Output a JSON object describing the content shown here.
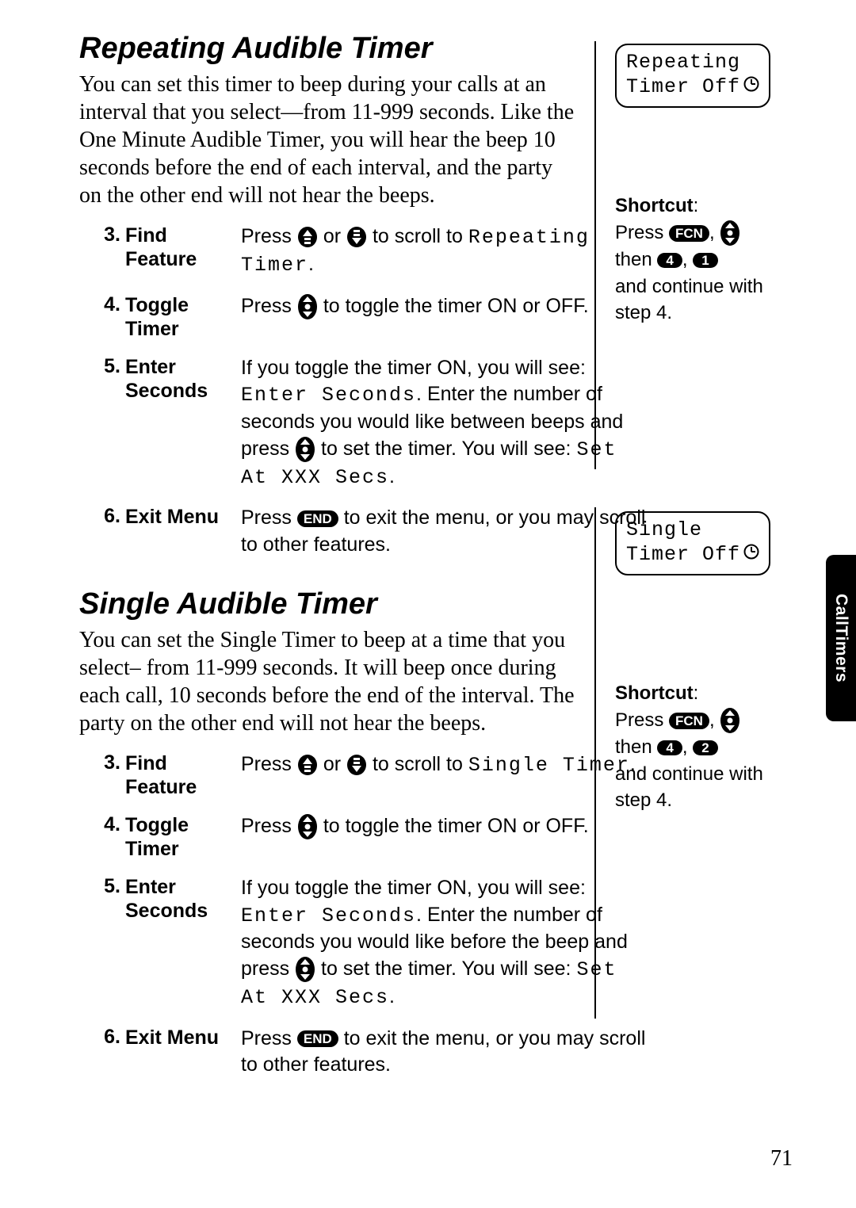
{
  "page_number": "71",
  "side_tab": "CallTimers",
  "sections": [
    {
      "title": "Repeating Audible Timer",
      "intro": "You can set this timer to beep during your calls at an interval that you select—from 11-999 seconds. Like the One Minute Audible Timer, you will hear the beep 10 seconds before the end of each interval, and the party on the other end will not hear the beeps.",
      "display": {
        "line1": "Repeating",
        "line2": "Timer Off"
      },
      "shortcut": {
        "label": "Shortcut",
        "line1_pre": "Press ",
        "fcn": "FCN",
        "then": "then",
        "digit1": "4",
        "digit2": "1",
        "tail": "and continue with step 4."
      },
      "steps": [
        {
          "num": "3.",
          "label": "Find Feature",
          "pre": "Press ",
          "mid": " or ",
          "post": " to scroll to ",
          "lcd": "Repeating Timer",
          "trail": "."
        },
        {
          "num": "4.",
          "label": "Toggle Timer",
          "pre": "Press ",
          "post": " to toggle the timer ON or OFF."
        },
        {
          "num": "5.",
          "label": "Enter Seconds",
          "pre": "If you toggle the timer ON, you will see: ",
          "lcd1": "Enter Seconds",
          "mid1": ". Enter the number of seconds you would like between beeps and press ",
          "mid2": " to set the timer. You will see: ",
          "lcd2": "Set At XXX Secs",
          "trail": "."
        },
        {
          "num": "6.",
          "label": "Exit Menu",
          "pre": "Press ",
          "end_key": "END",
          "post": " to exit the menu, or you may scroll to other features."
        }
      ]
    },
    {
      "title": "Single Audible Timer",
      "intro": "You can set the Single Timer to beep at a time that you select– from 11-999 seconds. It will beep once during each call, 10 seconds before the end of the interval. The party on the other end will not hear the beeps.",
      "display": {
        "line1": "Single",
        "line2": "Timer Off"
      },
      "shortcut": {
        "label": "Shortcut",
        "line1_pre": "Press ",
        "fcn": "FCN",
        "then": "then",
        "digit1": "4",
        "digit2": "2",
        "tail": "and continue with step 4."
      },
      "steps": [
        {
          "num": "3.",
          "label": "Find Feature",
          "pre": "Press ",
          "mid": " or ",
          "post": " to scroll to ",
          "lcd": "Single Timer",
          "trail": "."
        },
        {
          "num": "4.",
          "label": "Toggle Timer",
          "pre": "Press ",
          "post": " to toggle the timer ON or OFF."
        },
        {
          "num": "5.",
          "label": "Enter Seconds",
          "pre": "If you toggle the timer ON, you will see: ",
          "lcd1": "Enter Seconds",
          "mid1": ". Enter the number of seconds you would like before the beep and press ",
          "mid2": " to set the timer. You will see: ",
          "lcd2": "Set At XXX Secs",
          "trail": "."
        },
        {
          "num": "6.",
          "label": "Exit Menu",
          "pre": "Press ",
          "end_key": "END",
          "post": " to exit the menu, or you may scroll to other features."
        }
      ]
    }
  ]
}
